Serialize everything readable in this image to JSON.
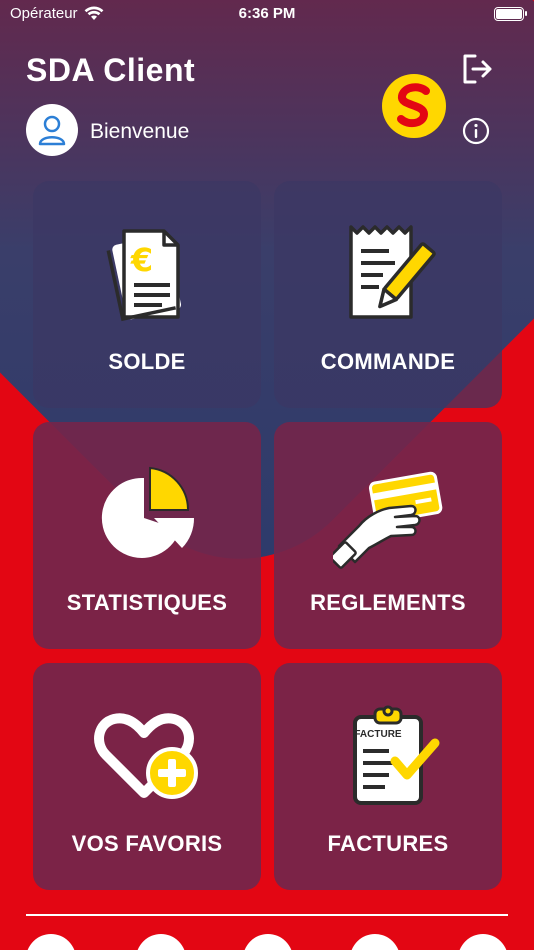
{
  "status_bar": {
    "carrier": "Opérateur",
    "time": "6:36 PM"
  },
  "header": {
    "title": "SDA Client",
    "welcome": "Bienvenue"
  },
  "tiles": [
    {
      "label": "SOLDE",
      "icon": "euro-document-icon"
    },
    {
      "label": "COMMANDE",
      "icon": "order-receipt-pen-icon"
    },
    {
      "label": "STATISTIQUES",
      "icon": "pie-chart-icon"
    },
    {
      "label": "REGLEMENTS",
      "icon": "hand-card-payment-icon"
    },
    {
      "label": "VOS FAVORIS",
      "icon": "heart-plus-icon"
    },
    {
      "label": "FACTURES",
      "icon": "invoice-clipboard-icon"
    }
  ],
  "invoice_icon_text": "FACTURE",
  "euro_symbol": "€",
  "colors": {
    "background": "#E30613",
    "tile": "#73264B",
    "accent_yellow": "#FFD700",
    "header_gradient_dark": "#2B3A6B"
  }
}
